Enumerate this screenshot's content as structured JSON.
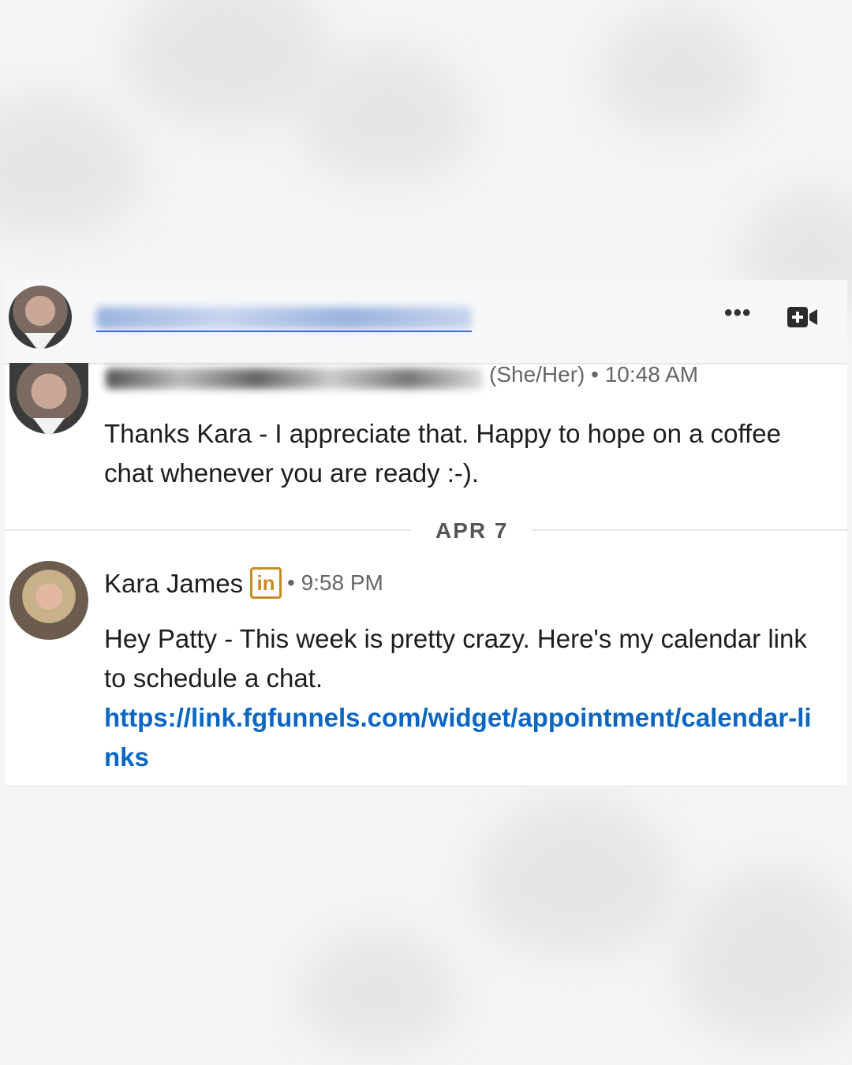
{
  "header": {
    "more_icon": "ellipsis-icon",
    "video_icon": "video-call-icon"
  },
  "messages": [
    {
      "pronouns_time": "(She/Her) • 10:48 AM",
      "text": "Thanks Kara - I appreciate that.  Happy to hope on a coffee chat whenever you are ready :-)."
    },
    {
      "sender": "Kara James",
      "badge": "in",
      "time": "• 9:58 PM",
      "text": "Hey Patty - This week is pretty crazy.  Here's my calendar link to schedule a chat.",
      "link": "https://link.fgfunnels.com/widget/appointment/calendar-links"
    }
  ],
  "date_divider": "APR 7",
  "colors": {
    "link": "#0a66c2",
    "badge": "#c98a24"
  }
}
